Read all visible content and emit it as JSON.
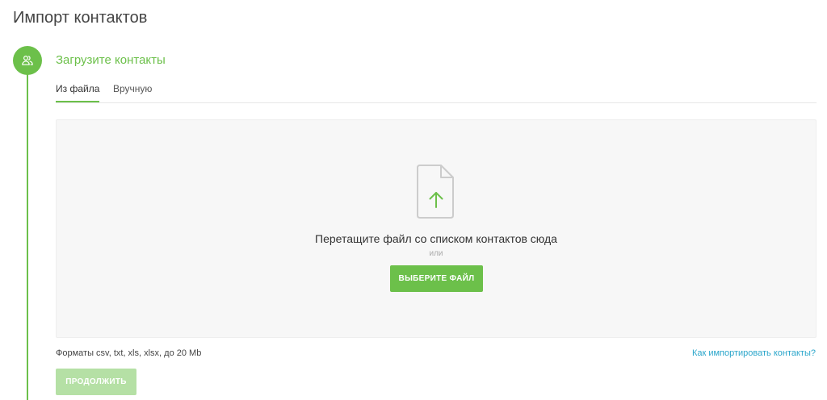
{
  "page": {
    "title": "Импорт контактов"
  },
  "step": {
    "icon": "users-icon",
    "title": "Загрузите контакты"
  },
  "tabs": [
    {
      "label": "Из файла",
      "active": true
    },
    {
      "label": "Вручную",
      "active": false
    }
  ],
  "dropzone": {
    "icon": "file-upload-icon",
    "instruction": "Перетащите файл со списком контактов сюда",
    "or_label": "или",
    "choose_button_label": "ВЫБЕРИТЕ ФАЙЛ"
  },
  "footer": {
    "formats_text": "Форматы csv, txt, xls, xlsx, до 20 Mb",
    "help_link_label": "Как импортировать контакты?",
    "continue_button_label": "ПРОДОЛЖИТЬ"
  },
  "colors": {
    "accent": "#6cc04a",
    "accent_disabled": "#b5e0a5",
    "link": "#2ba6cb",
    "dropzone_bg": "#f7f7f7"
  }
}
